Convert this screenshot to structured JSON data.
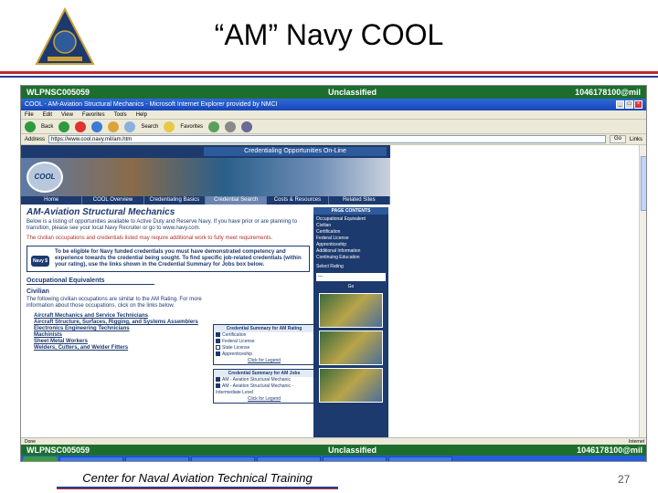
{
  "slide": {
    "title": "“AM” Navy COOL",
    "footer": "Center for Naval Aviation Technical Training",
    "page_number": "27"
  },
  "classification": {
    "left": "WLPNSC005059",
    "center": "Unclassified",
    "right": "1046178100@mil"
  },
  "browser": {
    "title": "COOL - AM-Aviation Structural Mechanics - Microsoft Internet Explorer provided by NMCI",
    "menu": [
      "File",
      "Edit",
      "View",
      "Favorites",
      "Tools",
      "Help"
    ],
    "back_label": "Back",
    "search_label": "Search",
    "favorites_label": "Favorites",
    "address_label": "Address",
    "address_value": "https://www.cool.navy.mil/am.htm",
    "go_label": "Go",
    "links_label": "Links",
    "status_left": "Done",
    "status_right": "Internet"
  },
  "site": {
    "banner": "Credentialing Opportunities On-Line",
    "logo": "COOL",
    "nav": [
      "Home",
      "COOL Overview",
      "Credentialing Basics",
      "Credential Search",
      "Costs & Resources",
      "Related Sites"
    ],
    "heading": "AM-Aviation Structural Mechanics",
    "intro": "Below is a listing of opportunities available to Active Duty and Reserve Navy. If you have prior or are planning to transition, please see your local Navy Recruiter or go to www.navy.com.",
    "note": "The civilian occupations and credentials listed may require additional work to fully meet requirements.",
    "notice": "To be eligible for Navy funded credentials you must have demonstrated competency and experience towards the credential being sought. To find specific job-related credentials (within your rating), use the links shown in the Credential Summary for Jobs box below.",
    "badge": "Navy $",
    "occ_heading": "Occupational Equivalents",
    "civilian_heading": "Civilian",
    "civilian_text": "The following civilian occupations are similar to the AM Rating. For more information about those occupations, click on the links below.",
    "occupations": [
      "Aircraft Mechanics and Service Technicians",
      "Aircraft Structure, Surfaces, Rigging, and Systems Assemblers",
      "Electronics Engineering Technicians",
      "Machinists",
      "Sheet Metal Workers",
      "Welders, Cutters, and Welder Fitters"
    ]
  },
  "summary_rating": {
    "header": "Credential Summary for AM Rating",
    "rows": [
      "Certification",
      "Federal License",
      "State License",
      "Apprenticeship"
    ],
    "legend": "Click for Legend"
  },
  "summary_jobs": {
    "header": "Credential Summary for AM Jobs",
    "rows": [
      "AM - Aviation Structural Mechanic",
      "AM - Aviation Structural Mechanic - Intermediate Level"
    ],
    "legend": "Click for Legend"
  },
  "page_contents": {
    "header": "PAGE CONTENTS",
    "items": [
      "Occupational Equivalent",
      "Civilian",
      "Certification",
      "Federal License",
      "Apprenticeship",
      "Additional Information",
      "Continuing Education"
    ],
    "select_label": "Select Rating",
    "select_value": "---",
    "go": "Go"
  },
  "colors": {
    "classification_bar": "#1d6e2e",
    "site_navy": "#1c3a6e",
    "slide_rule_red": "#c0282d",
    "slide_rule_blue": "#2a3f8f"
  }
}
